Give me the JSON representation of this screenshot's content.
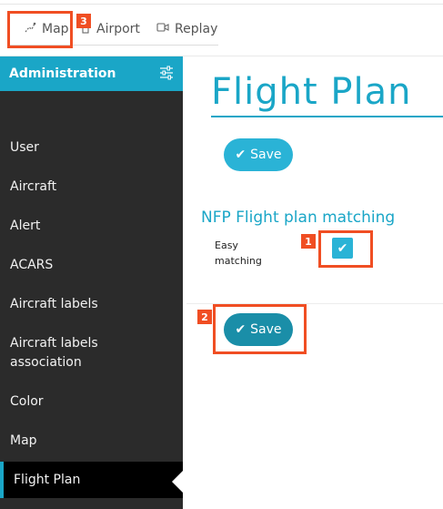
{
  "topnav": {
    "items": [
      {
        "label": "Map",
        "icon": "map-icon"
      },
      {
        "label": "Airport",
        "icon": "airport-icon"
      },
      {
        "label": "Replay",
        "icon": "replay-icon"
      }
    ]
  },
  "sidebar": {
    "header": "Administration",
    "items": [
      {
        "label": "User"
      },
      {
        "label": "Aircraft"
      },
      {
        "label": "Alert"
      },
      {
        "label": "ACARS"
      },
      {
        "label": "Aircraft labels"
      },
      {
        "label": "Aircraft labels association"
      },
      {
        "label": "Color"
      },
      {
        "label": "Map"
      },
      {
        "label": "Flight Plan",
        "active": true
      }
    ]
  },
  "main": {
    "title": "Flight Plan",
    "save_label": "Save",
    "section_title": "NFP Flight plan matching",
    "field_label": "Easy matching",
    "easy_matching_checked": true
  },
  "callouts": {
    "one": "1",
    "two": "2",
    "three": "3"
  },
  "colors": {
    "accent": "#1aa6c7",
    "sidebar_bg": "#2b2b2b",
    "callout": "#f04e23"
  }
}
